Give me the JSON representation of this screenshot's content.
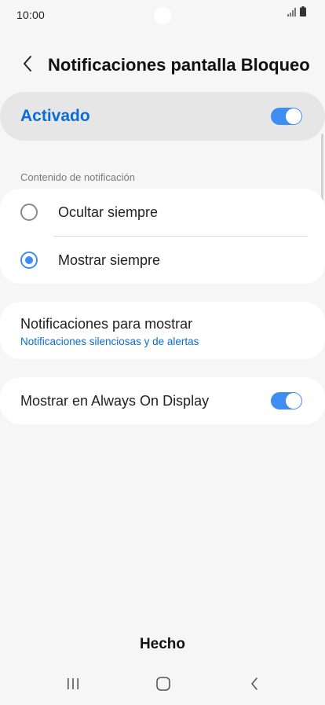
{
  "status_bar": {
    "time": "10:00",
    "icons": [
      "signal-icon",
      "battery-icon"
    ]
  },
  "header": {
    "title": "Notificaciones pantalla Bloqueo",
    "back_icon": "chevron-left-icon"
  },
  "master_toggle": {
    "label": "Activado",
    "on": true
  },
  "content_section": {
    "header": "Contenido de notificación",
    "options": [
      {
        "label": "Ocultar siempre",
        "selected": false
      },
      {
        "label": "Mostrar siempre",
        "selected": true
      }
    ]
  },
  "notifications_to_show": {
    "title": "Notificaciones para mostrar",
    "value": "Notificaciones silenciosas y de alertas"
  },
  "always_on_display": {
    "label": "Mostrar en Always On Display",
    "on": true
  },
  "footer": {
    "done_label": "Hecho"
  },
  "nav_bar": {
    "buttons": [
      "recents-icon",
      "home-icon",
      "back-icon"
    ]
  },
  "colors": {
    "accent": "#3d8ef0",
    "accent_text": "#0a6cd5",
    "background": "#f6f6f6",
    "card": "#ffffff",
    "master_card": "#e6e6e6"
  }
}
